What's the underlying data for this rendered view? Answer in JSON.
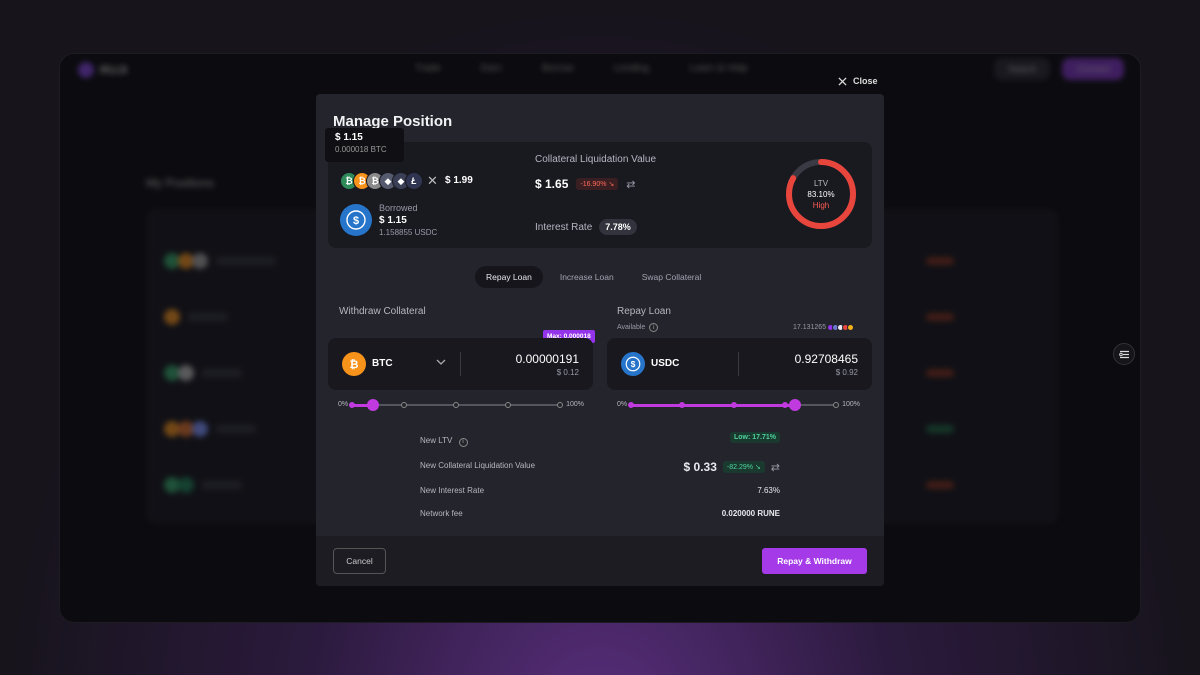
{
  "background_app": {
    "nav_links": [
      "Trade",
      "Earn",
      "Borrow",
      "Lending",
      "Learn & Help"
    ],
    "nav_right": [
      "Search",
      "Connect"
    ],
    "section_title": "My Positions"
  },
  "close": {
    "label": "Close"
  },
  "modal": {
    "title": "Manage Position",
    "tooltip": {
      "usd": "$ 1.15",
      "amount": "0.000018 BTC"
    },
    "collateral_value": "$ 1.99",
    "borrowed": {
      "label": "Borrowed",
      "usd": "$ 1.15",
      "amount": "1.158855 USDC"
    },
    "clv": {
      "label": "Collateral Liquidation Value",
      "value": "$ 1.65",
      "change": "-16.90% ↘"
    },
    "interest_rate": {
      "label": "Interest Rate",
      "value": "7.78%"
    },
    "ltv": {
      "label": "LTV",
      "value": "83.10%",
      "status": "High",
      "fraction": 0.831
    },
    "tabs": [
      {
        "label": "Repay Loan",
        "active": true
      },
      {
        "label": "Increase Loan",
        "active": false
      },
      {
        "label": "Swap Collateral",
        "active": false
      }
    ],
    "withdraw": {
      "label": "Withdraw Collateral",
      "max_badge": "Max: 0.000018",
      "coin": "BTC",
      "amount": "0.00000191",
      "usd": "$ 0.12",
      "slider_min": "0%",
      "slider_max": "100%",
      "slider_value": 0.1
    },
    "repay": {
      "label": "Repay Loan",
      "available_label": "Available",
      "available_amount": "17.131265",
      "coin": "USDC",
      "amount": "0.92708465",
      "usd": "$ 0.92",
      "slider_min": "0%",
      "slider_max": "100%",
      "slider_value": 0.8
    },
    "details": {
      "new_ltv": {
        "label": "New LTV",
        "value": "Low: 17.71%"
      },
      "new_clv": {
        "label": "New Collateral Liquidation Value",
        "value": "$ 0.33",
        "change": "-82.29% ↘"
      },
      "new_ir": {
        "label": "New Interest Rate",
        "value": "7.63%"
      },
      "fee": {
        "label": "Network fee",
        "value": "0.020000 RUNE"
      }
    },
    "footer": {
      "cancel": "Cancel",
      "submit": "Repay & Withdraw"
    }
  },
  "colors": {
    "accent": "#a53ae8",
    "danger": "#ff5c52",
    "success": "#4fd39c",
    "btc": "#f7931a",
    "usdc": "#2775ca"
  },
  "icons": [
    "close-icon",
    "chevron-down-icon",
    "info-icon",
    "swap-arrows-icon",
    "filter-icon",
    "btc-icon",
    "usdc-icon"
  ]
}
